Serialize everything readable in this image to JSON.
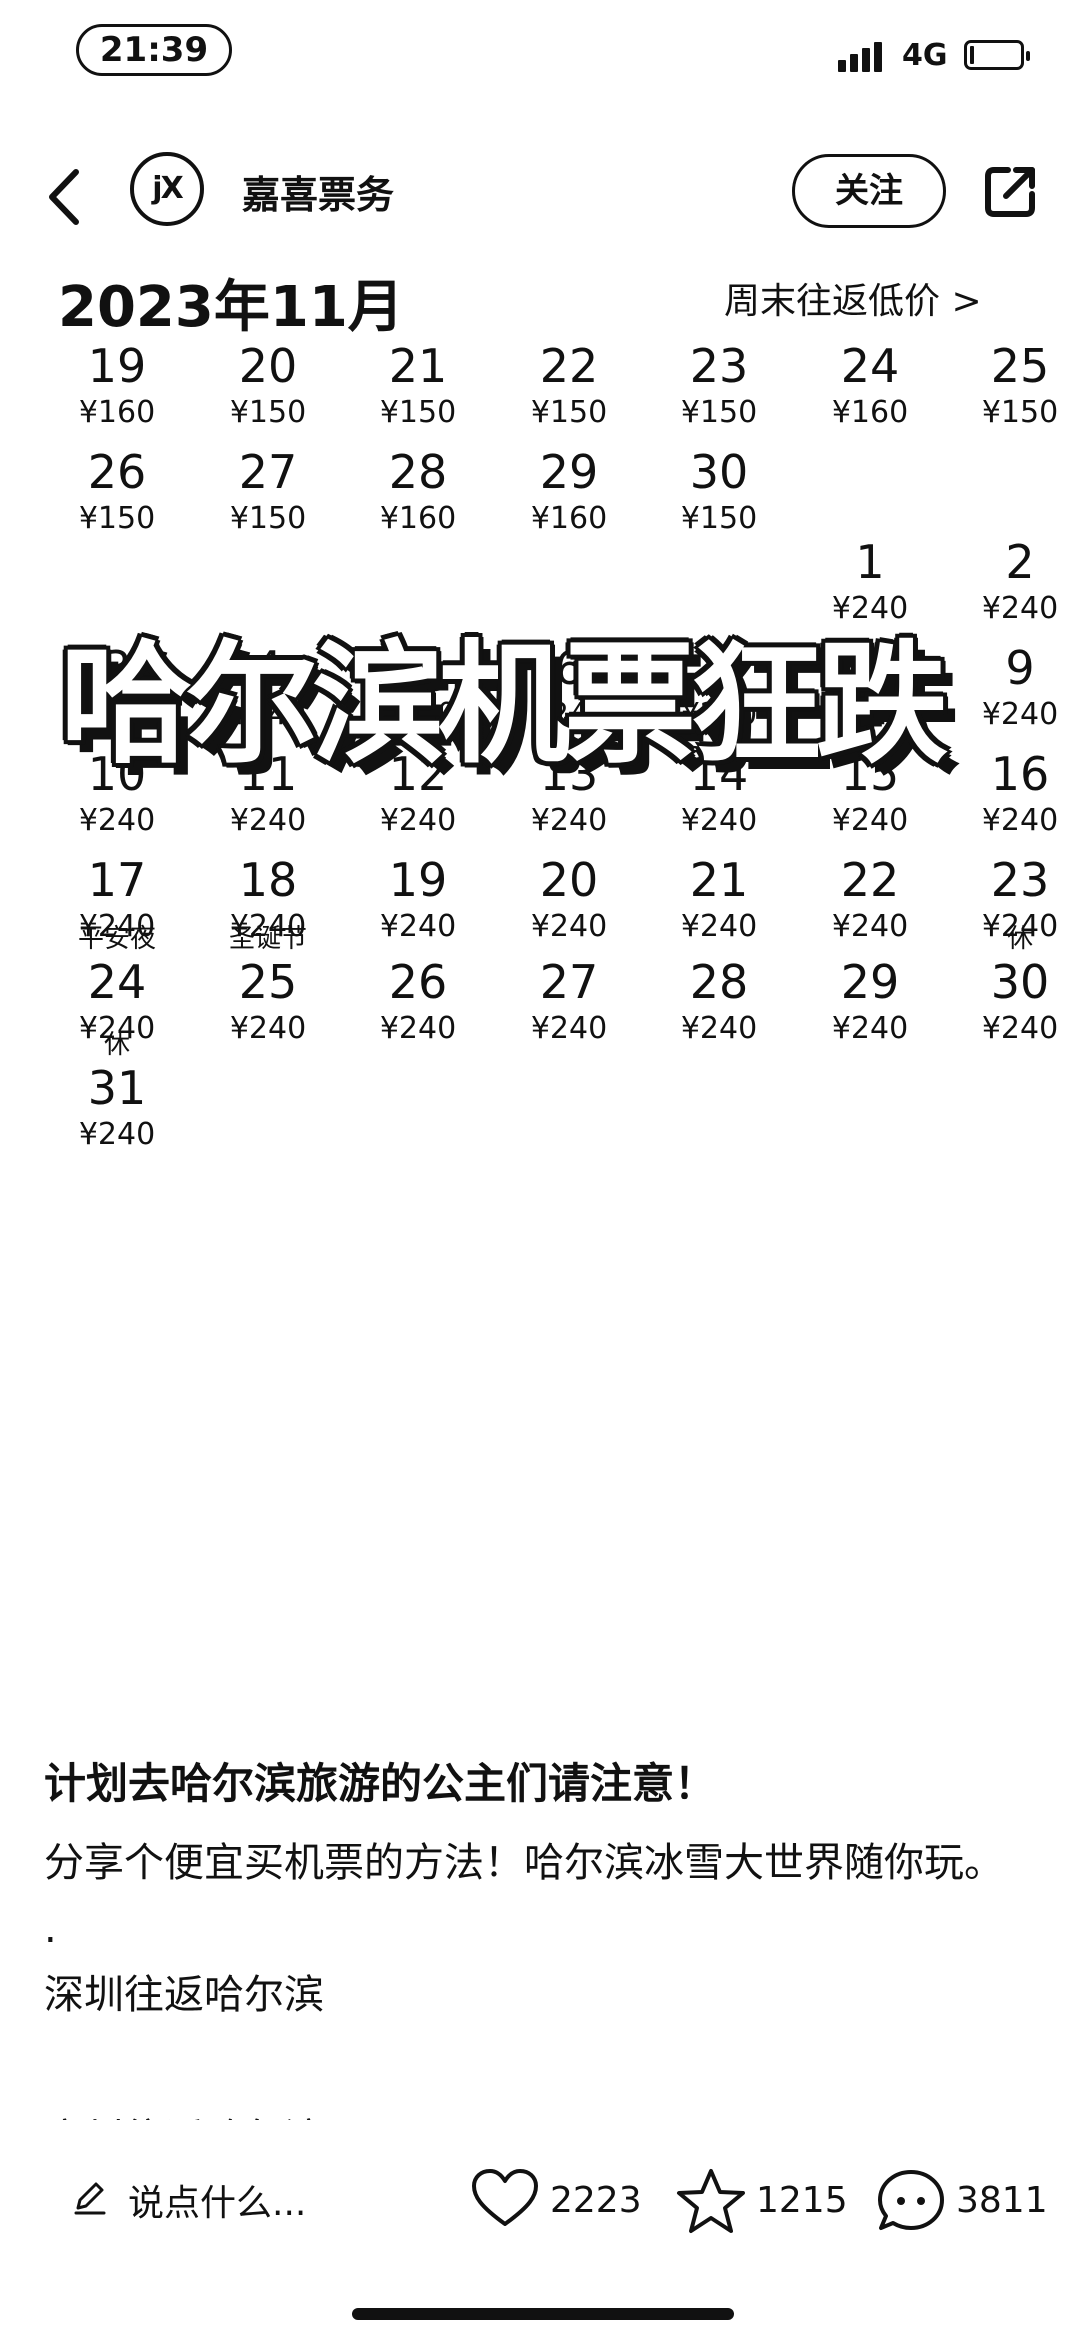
{
  "status_bar": {
    "time": "21:39",
    "network": "4G"
  },
  "header": {
    "author": "嘉喜票务",
    "avatar_text": "jX",
    "follow_label": "关注"
  },
  "calendar": {
    "month_title": "2023年11月",
    "weekend_link": "周末往返低价 >",
    "november": [
      {
        "d": "19",
        "p": "¥160"
      },
      {
        "d": "20",
        "p": "¥150"
      },
      {
        "d": "21",
        "p": "¥150"
      },
      {
        "d": "22",
        "p": "¥150"
      },
      {
        "d": "23",
        "p": "¥150"
      },
      {
        "d": "24",
        "p": "¥160"
      },
      {
        "d": "25",
        "p": "¥150"
      },
      {
        "d": "26",
        "p": "¥150"
      },
      {
        "d": "27",
        "p": "¥150"
      },
      {
        "d": "28",
        "p": "¥160"
      },
      {
        "d": "29",
        "p": "¥160"
      },
      {
        "d": "30",
        "p": "¥150"
      }
    ],
    "december": [
      {
        "d": "1",
        "p": "¥240"
      },
      {
        "d": "2",
        "p": "¥240"
      },
      {
        "d": "3",
        "p": "¥240"
      },
      {
        "d": "4",
        "p": "¥240"
      },
      {
        "d": "5",
        "p": "¥240"
      },
      {
        "d": "6",
        "p": "¥240"
      },
      {
        "d": "7",
        "p": "¥240"
      },
      {
        "d": "8",
        "p": "¥240"
      },
      {
        "d": "9",
        "p": "¥240"
      },
      {
        "d": "10",
        "p": "¥240"
      },
      {
        "d": "11",
        "p": "¥240"
      },
      {
        "d": "12",
        "p": "¥240"
      },
      {
        "d": "13",
        "p": "¥240"
      },
      {
        "d": "14",
        "p": "¥240"
      },
      {
        "d": "15",
        "p": "¥240"
      },
      {
        "d": "16",
        "p": "¥240"
      },
      {
        "d": "17",
        "p": "¥240"
      },
      {
        "d": "18",
        "p": "¥240"
      },
      {
        "d": "19",
        "p": "¥240"
      },
      {
        "d": "20",
        "p": "¥240"
      },
      {
        "d": "21",
        "p": "¥240"
      },
      {
        "d": "22",
        "p": "¥240"
      },
      {
        "d": "23",
        "p": "¥240"
      },
      {
        "d": "24",
        "p": "¥240",
        "tag": "平安夜"
      },
      {
        "d": "25",
        "p": "¥240",
        "tag": "圣诞节"
      },
      {
        "d": "26",
        "p": "¥240"
      },
      {
        "d": "27",
        "p": "¥240"
      },
      {
        "d": "28",
        "p": "¥240"
      },
      {
        "d": "29",
        "p": "¥240"
      },
      {
        "d": "30",
        "p": "¥240",
        "tag": "休"
      },
      {
        "d": "31",
        "p": "¥240",
        "tag": "休"
      }
    ]
  },
  "overlay_text": "哈尔滨机票狂跌",
  "post": {
    "title": "计划去哈尔滨旅游的公主们请注意！",
    "line1": "分享个便宜买机票的方法！哈尔滨冰雪大世界随你玩。",
    "line2": ".",
    "line3": "深圳往返哈尔滨",
    "line4_cut": "广州往返哈尔滨"
  },
  "bottom_bar": {
    "comment_placeholder": "说点什么...",
    "likes": "2223",
    "stars": "1215",
    "comments": "3811"
  }
}
